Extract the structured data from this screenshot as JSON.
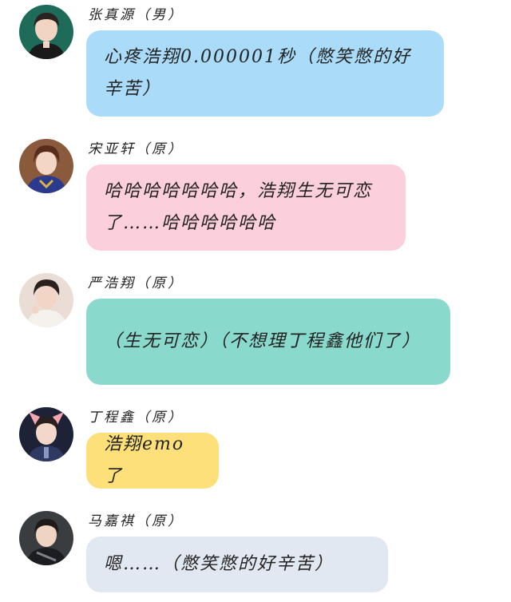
{
  "messages": [
    {
      "name": "张真源（男）",
      "text": "心疼浩翔0.000001秒（憋笑憋的好辛苦）",
      "bubble_color": "#aadcfa",
      "avatar_icon": "avatar-zhang-zhenyuan"
    },
    {
      "name": "宋亚轩（原）",
      "text": "哈哈哈哈哈哈哈，浩翔生无可恋了……哈哈哈哈哈哈",
      "bubble_color": "#fbcfdb",
      "avatar_icon": "avatar-song-yaxuan"
    },
    {
      "name": "严浩翔（原）",
      "text": "（生无可恋）（不想理丁程鑫他们了）",
      "bubble_color": "#8ad9cd",
      "avatar_icon": "avatar-yan-haoxiang"
    },
    {
      "name": "丁程鑫（原）",
      "text": "浩翔emo了",
      "bubble_color": "#fde07a",
      "avatar_icon": "avatar-ding-chengxin"
    },
    {
      "name": "马嘉祺（原）",
      "text": "嗯……（憋笑憋的好辛苦）",
      "bubble_color": "#e2e8f1",
      "avatar_icon": "avatar-ma-jiaqi"
    }
  ]
}
